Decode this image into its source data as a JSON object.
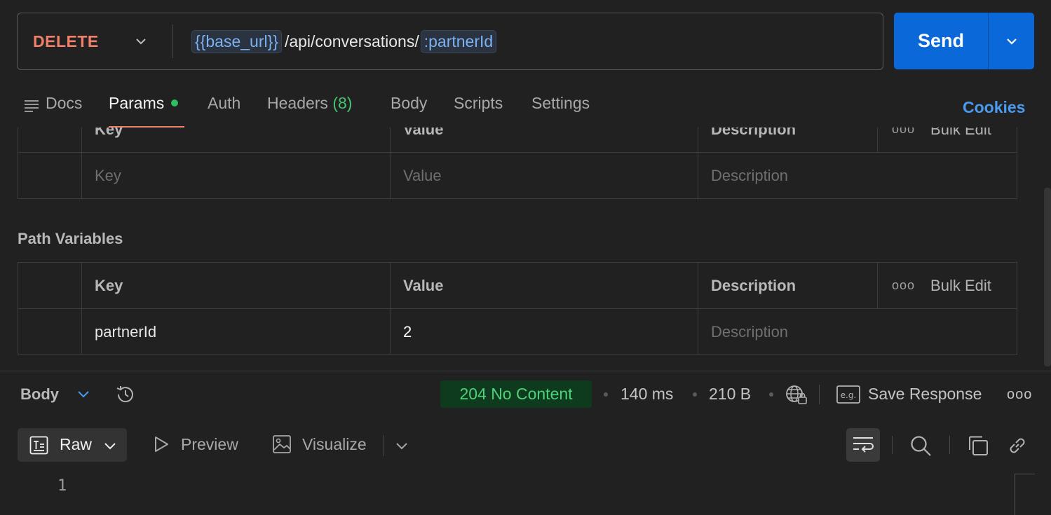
{
  "request": {
    "method": "DELETE",
    "url": {
      "base_var": "{{base_url}}",
      "path": "/api/conversations/",
      "path_var": ":partnerId"
    },
    "send_label": "Send"
  },
  "tabs": {
    "docs": "Docs",
    "params": "Params",
    "auth": "Auth",
    "headers": "Headers",
    "headers_count": "(8)",
    "body": "Body",
    "scripts": "Scripts",
    "settings": "Settings",
    "cookies": "Cookies"
  },
  "query_params": {
    "headers": {
      "key": "Key",
      "value": "Value",
      "description": "Description",
      "bulk_edit": "Bulk Edit"
    },
    "empty_row": {
      "key_placeholder": "Key",
      "value_placeholder": "Value",
      "description_placeholder": "Description"
    }
  },
  "path_variables": {
    "title": "Path Variables",
    "headers": {
      "key": "Key",
      "value": "Value",
      "description": "Description",
      "bulk_edit": "Bulk Edit"
    },
    "rows": [
      {
        "key": "partnerId",
        "value": "2",
        "description_placeholder": "Description"
      }
    ]
  },
  "response": {
    "section_label": "Body",
    "status": "204 No Content",
    "time": "140 ms",
    "size": "210 B",
    "save_response": "Save Response",
    "format_selected": "Raw",
    "preview": "Preview",
    "visualize": "Visualize",
    "line_numbers": [
      "1"
    ]
  },
  "colors": {
    "method": "#f0806a",
    "send": "#0a68d9",
    "status_bg": "#0e3a1d",
    "status_text": "#4fd07a",
    "active_underline": "#f0806a",
    "variable": "#7bb2f2"
  }
}
